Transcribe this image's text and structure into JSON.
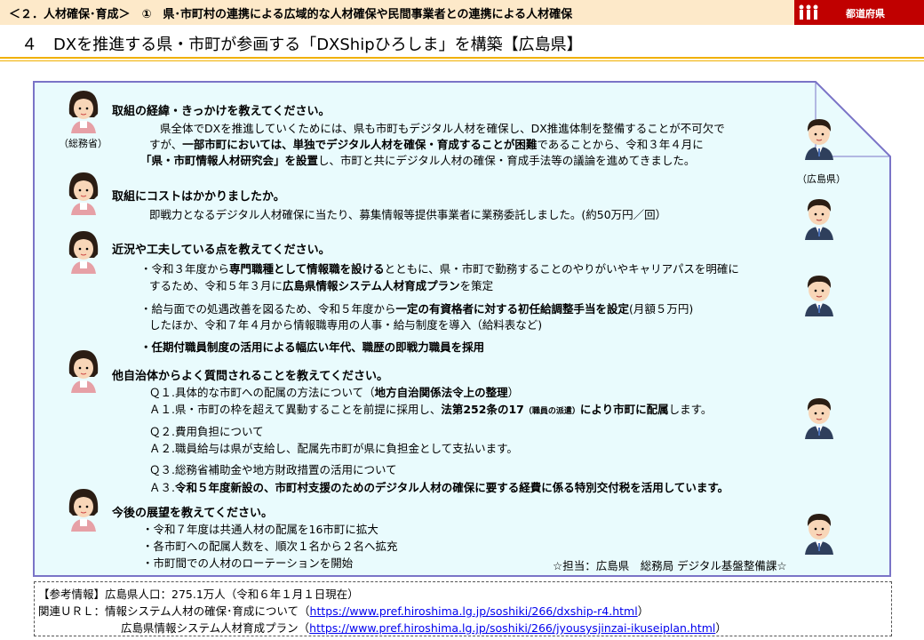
{
  "header": {
    "title": "＜２．人材確保･育成＞　①　県･市町村の連携による広域的な人材確保や民間事業者との連携による人材確保",
    "badge": "都道府県",
    "subtitle": "４　DXを推進する県・市町が参画する「DXShipひろしま」を構築【広島県】"
  },
  "captions": {
    "left": "（総務省）",
    "right": "（広島県）"
  },
  "sections": {
    "s1": {
      "question": "取組の経緯・きっかけを教えてください。",
      "l1": "県全体でDXを推進していくためには、県も市町もデジタル人材を確保し、DX推進体制を整備することが不可欠で",
      "l2a": "すが、",
      "l2b": "一部市町においては、単独でデジタル人材を確保・育成することが困難",
      "l2c": "であることから、令和３年４月に",
      "l3a": "「県・市町情報人材研究会」を設置",
      "l3b": "し、市町と共にデジタル人材の確保・育成手法等の議論を進めてきました。"
    },
    "s2": {
      "question": "取組にコストはかかりましたか。",
      "l1": "即戦力となるデジタル人材確保に当たり、募集情報等提供事業者に業務委託しました。(約50万円／回）"
    },
    "s3": {
      "question": "近況や工夫している点を教えてください。",
      "b1a": "・令和３年度から",
      "b1b": "専門職種として情報職を設ける",
      "b1c": "とともに、県・市町で勤務することのやりがいやキャリアパスを明確に",
      "b1d": "するため、令和５年３月に",
      "b1e": "広島県情報システム人材育成プラン",
      "b1f": "を策定",
      "b2a": "・給与面での処遇改善を図るため、令和５年度から",
      "b2b": "一定の有資格者に対する初任給調整手当を設定",
      "b2c": "(月額５万円)",
      "b2d": "したほか、令和７年４月から情報職専用の人事・給与制度を導入（給料表など)",
      "b3": "・任期付職員制度の活用による幅広い年代、職歴の即戦力職員を採用"
    },
    "s4": {
      "question": "他自治体からよく質問されることを教えてください。",
      "q1a": "Ｑ１.具体的な市町への配属の方法について（",
      "q1b": "地方自治関係法令上の整理",
      "q1c": "）",
      "a1a": "Ａ１.県・市町の枠を超えて異動することを前提に採用し、",
      "a1b": "法第252条の17",
      "a1c": "（職員の派遣）",
      "a1d": "により市町に配属",
      "a1e": "します。",
      "q2": "Ｑ２.費用負担について",
      "a2": "Ａ２.職員給与は県が支給し、配属先市町が県に負担金として支払います。",
      "q3": "Ｑ３.総務省補助金や地方財政措置の活用について",
      "a3a": "Ａ３.",
      "a3b": "令和５年度新設の、市町村支援のためのデジタル人材の確保に要する経費に係る特別交付税を活用しています。"
    },
    "s5": {
      "question": "今後の展望を教えてください。",
      "b1": "・令和７年度は共通人材の配属を16市町に拡大",
      "b2": "・各市町への配属人数を、順次１名から２名へ拡充",
      "b3": "・市町間での人材のローテーションを開始",
      "contact": "☆担当：広島県　総務局 デジタル基盤整備課☆"
    }
  },
  "footer": {
    "label": "【参考情報】",
    "population": "広島県人口：275.1万人（令和６年１月１日現在）",
    "rel_label": "関連ＵＲＬ：",
    "link1_title": "情報システム人材の確保･育成について（",
    "link1_url": "https://www.pref.hiroshima.lg.jp/soshiki/266/dxship-r4.html",
    "link1_close": "）",
    "link2_title": "広島県情報システム人材育成プラン（",
    "link2_url": "https://www.pref.hiroshima.lg.jp/soshiki/266/jyousysjinzai-ikuseiplan.html",
    "link2_close": "）"
  },
  "colors": {
    "header_bg": "#fde9c9",
    "badge_bg": "#c00000",
    "rule": "#f0b000",
    "panel_bg": "#e9fbfd",
    "panel_border": "#7a74c7"
  }
}
